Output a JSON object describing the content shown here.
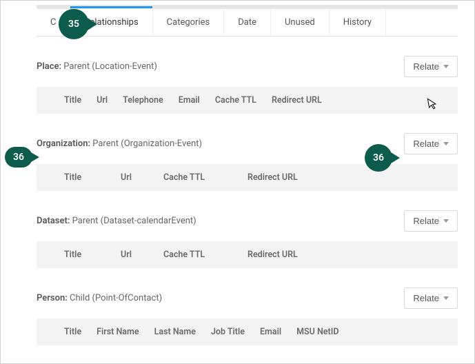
{
  "tabs": {
    "t0": "C",
    "t1": "Relationships",
    "t2": "Categories",
    "t3": "Date",
    "t4": "Unused",
    "t5": "History"
  },
  "relate_label": "Relate",
  "sections": {
    "place": {
      "label": "Place:",
      "desc": "Parent (Location-Event)",
      "cols": {
        "c0": "Title",
        "c1": "Url",
        "c2": "Telephone",
        "c3": "Email",
        "c4": "Cache TTL",
        "c5": "Redirect URL"
      }
    },
    "organization": {
      "label": "Organization:",
      "desc": "Parent (Organization-Event)",
      "cols": {
        "c0": "Title",
        "c1": "Url",
        "c2": "Cache TTL",
        "c3": "Redirect URL"
      }
    },
    "dataset": {
      "label": "Dataset:",
      "desc": "Parent (Dataset-calendarEvent)",
      "cols": {
        "c0": "Title",
        "c1": "Url",
        "c2": "Cache TTL",
        "c3": "Redirect URL"
      }
    },
    "person": {
      "label": "Person:",
      "desc": "Child (Point-OfContact)",
      "cols": {
        "c0": "Title",
        "c1": "First Name",
        "c2": "Last Name",
        "c3": "Job Title",
        "c4": "Email",
        "c5": "MSU NetID"
      }
    }
  },
  "annotations": {
    "a35": "35",
    "a36l": "36",
    "a36r": "36"
  }
}
